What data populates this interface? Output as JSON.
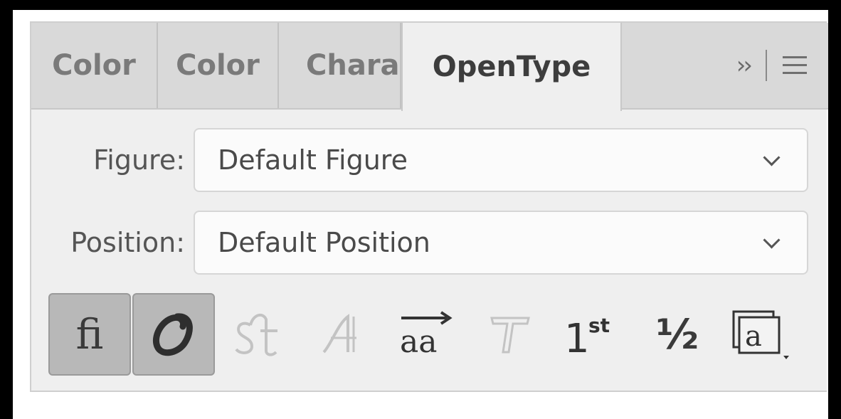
{
  "tabs": [
    {
      "label": "Color",
      "active": false
    },
    {
      "label": "Color",
      "active": false
    },
    {
      "label": "Chara",
      "active": false
    },
    {
      "label": "OpenType",
      "active": true
    }
  ],
  "tab_controls": {
    "overflow_icon": "double-chevron-right",
    "menu_icon": "hamburger-menu"
  },
  "fields": {
    "figure": {
      "label": "Figure:",
      "value": "Default Figure"
    },
    "position": {
      "label": "Position:",
      "value": "Default Position"
    }
  },
  "features": [
    {
      "name": "standard-ligatures",
      "glyph": "ﬁ",
      "state": "pressed"
    },
    {
      "name": "swash",
      "glyph": "𝒪",
      "state": "pressed"
    },
    {
      "name": "discretionary-ligatures",
      "glyph": "st",
      "state": "disabled"
    },
    {
      "name": "stylistic-alternates",
      "glyph": "𝒜",
      "state": "disabled"
    },
    {
      "name": "contextual-alternates",
      "glyph": "aa",
      "state": "enabled"
    },
    {
      "name": "titling-alternates",
      "glyph": "𝕋",
      "state": "disabled"
    },
    {
      "name": "ordinal",
      "glyph": "1st",
      "state": "enabled"
    },
    {
      "name": "fractions",
      "glyph": "½",
      "state": "enabled"
    },
    {
      "name": "stylistic-sets",
      "glyph": "a",
      "state": "enabled"
    }
  ]
}
